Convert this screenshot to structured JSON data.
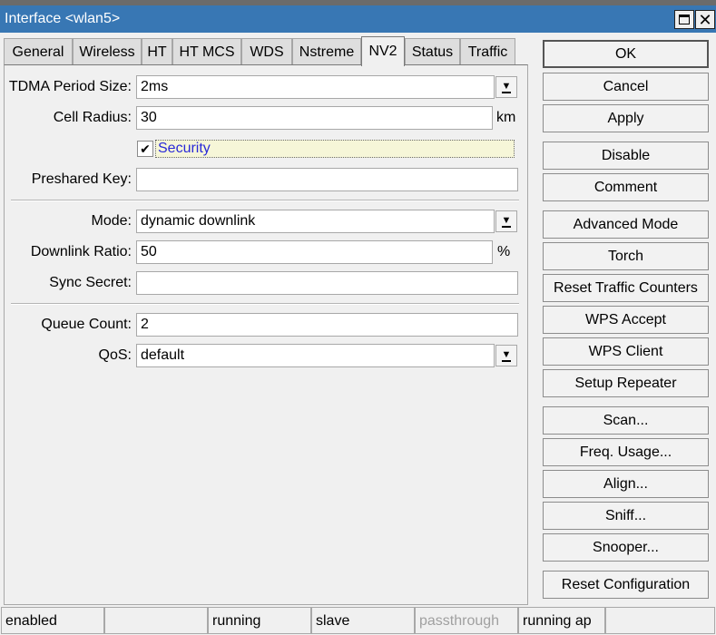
{
  "window": {
    "title": "Interface <wlan5>"
  },
  "tabs": [
    {
      "label": "General"
    },
    {
      "label": "Wireless"
    },
    {
      "label": "HT"
    },
    {
      "label": "HT MCS"
    },
    {
      "label": "WDS"
    },
    {
      "label": "Nstreme"
    },
    {
      "label": "NV2",
      "active": true
    },
    {
      "label": "Status"
    },
    {
      "label": "Traffic"
    }
  ],
  "form": {
    "tdma_period_size": {
      "label": "TDMA Period Size:",
      "value": "2ms"
    },
    "cell_radius": {
      "label": "Cell Radius:",
      "value": "30",
      "unit": "km"
    },
    "security": {
      "label": "Security",
      "checked": true,
      "check_glyph": "✔"
    },
    "preshared_key": {
      "label": "Preshared Key:",
      "value": ""
    },
    "mode": {
      "label": "Mode:",
      "value": "dynamic downlink"
    },
    "downlink_ratio": {
      "label": "Downlink Ratio:",
      "value": "50",
      "unit": "%"
    },
    "sync_secret": {
      "label": "Sync Secret:",
      "value": ""
    },
    "queue_count": {
      "label": "Queue Count:",
      "value": "2"
    },
    "qos": {
      "label": "QoS:",
      "value": "default"
    }
  },
  "buttons": [
    {
      "label": "OK"
    },
    {
      "label": "Cancel"
    },
    {
      "label": "Apply"
    },
    {
      "label": "Disable"
    },
    {
      "label": "Comment"
    },
    {
      "label": "Advanced Mode"
    },
    {
      "label": "Torch"
    },
    {
      "label": "Reset Traffic Counters"
    },
    {
      "label": "WPS Accept"
    },
    {
      "label": "WPS Client"
    },
    {
      "label": "Setup Repeater"
    },
    {
      "label": "Scan..."
    },
    {
      "label": "Freq. Usage..."
    },
    {
      "label": "Align..."
    },
    {
      "label": "Sniff..."
    },
    {
      "label": "Snooper..."
    },
    {
      "label": "Reset Configuration"
    }
  ],
  "status": [
    {
      "text": "enabled"
    },
    {
      "text": ""
    },
    {
      "text": "running"
    },
    {
      "text": "slave"
    },
    {
      "text": "passthrough",
      "dimmed": true
    },
    {
      "text": "running ap"
    },
    {
      "text": ""
    }
  ],
  "icons": {
    "maximize": "maximize-icon",
    "close": "close-icon",
    "dropdown": "dropdown-arrow-icon",
    "checkbox": "checkmark-icon"
  },
  "colors": {
    "titlebar": "#3877b4",
    "background": "#f0f0f0",
    "security_text": "#2a2ad8"
  },
  "glyphs": {
    "close": "✕",
    "dropdown": "▼"
  }
}
